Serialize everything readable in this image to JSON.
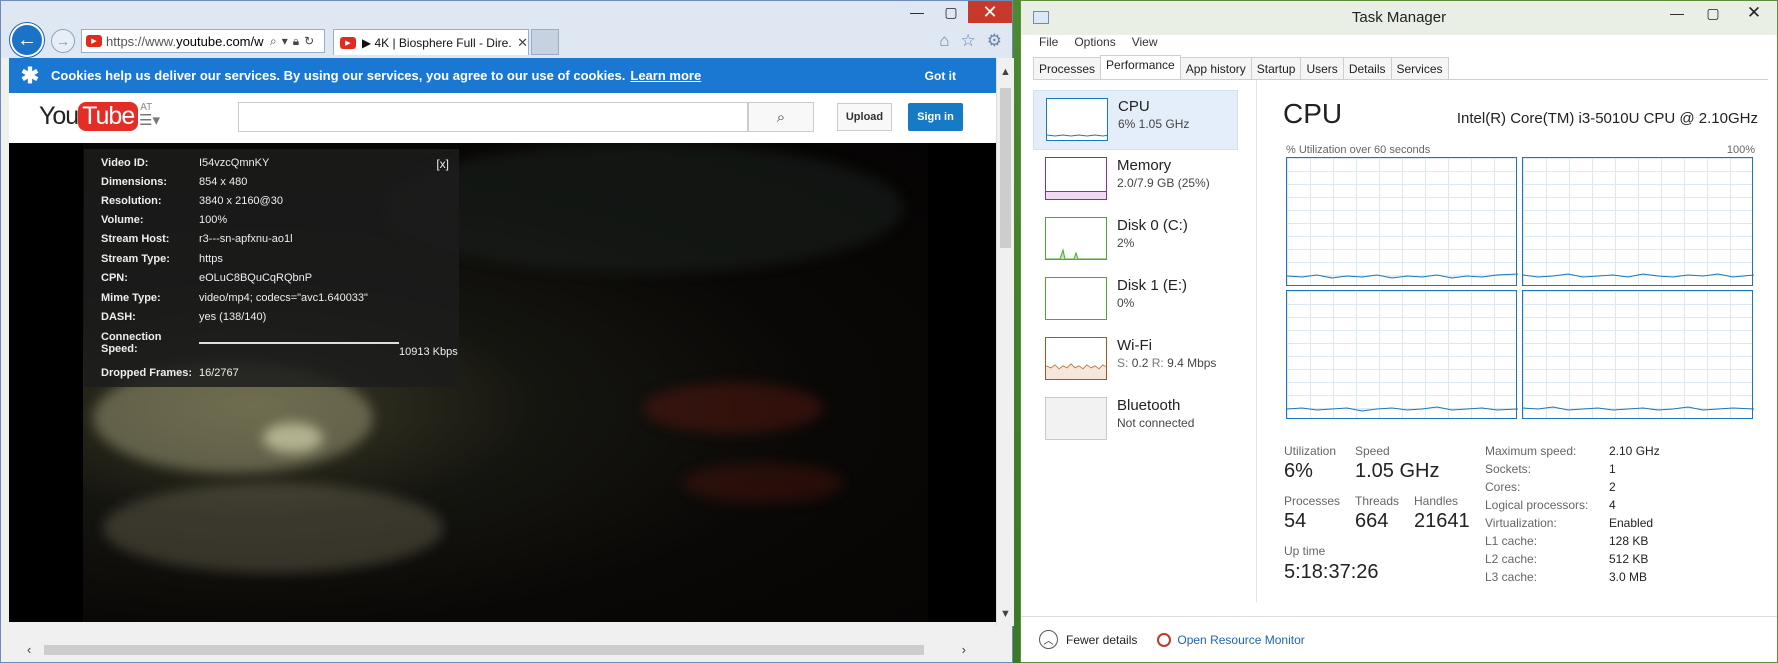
{
  "browser": {
    "url_prefix": "https://www.",
    "url_host": "youtube.com/w",
    "tab_title": "▶ 4K | Biosphere Full - Dire...",
    "cookie_text": "Cookies help us deliver our services. By using our services, you agree to our use of cookies.",
    "cookie_link": "Learn more",
    "cookie_button": "Got it",
    "yt_logo_you": "You",
    "yt_logo_tube": "Tube",
    "yt_region": "AT",
    "upload_label": "Upload",
    "signin_label": "Sign in",
    "stats_close": "[x]",
    "stats": [
      {
        "key": "Video ID:",
        "value": "I54vzcQmnKY"
      },
      {
        "key": "Dimensions:",
        "value": "854 x 480"
      },
      {
        "key": "Resolution:",
        "value": "3840 x 2160@30"
      },
      {
        "key": "Volume:",
        "value": "100%"
      },
      {
        "key": "Stream Host:",
        "value": "r3---sn-apfxnu-ao1l"
      },
      {
        "key": "Stream Type:",
        "value": "https"
      },
      {
        "key": "CPN:",
        "value": "eOLuC8BQuCqRQbnP"
      },
      {
        "key": "Mime Type:",
        "value": "video/mp4; codecs=\"avc1.640033\""
      },
      {
        "key": "DASH:",
        "value": "yes (138/140)"
      },
      {
        "key": "Connection Speed:",
        "value": "10913 Kbps"
      },
      {
        "key": "Dropped Frames:",
        "value": "16/2767"
      }
    ]
  },
  "taskmanager": {
    "title": "Task Manager",
    "menu": [
      "File",
      "Options",
      "View"
    ],
    "tabs": [
      "Processes",
      "Performance",
      "App history",
      "Startup",
      "Users",
      "Details",
      "Services"
    ],
    "active_tab": "Performance",
    "resources": [
      {
        "name": "CPU",
        "sub": "6% 1.05 GHz",
        "color": "#1779ba"
      },
      {
        "name": "Memory",
        "sub": "2.0/7.9 GB (25%)",
        "color": "#8b2d9e"
      },
      {
        "name": "Disk 0 (C:)",
        "sub": "2%",
        "color": "#4caa2c"
      },
      {
        "name": "Disk 1 (E:)",
        "sub": "0%",
        "color": "#4caa2c"
      },
      {
        "name": "Wi-Fi",
        "sub_s": "S:",
        "sub_s_val": "0.2",
        "sub_r": "R:",
        "sub_r_val": "9.4 Mbps",
        "color": "#a7551f"
      },
      {
        "name": "Bluetooth",
        "sub": "Not connected",
        "color": "#9a9a9a"
      }
    ],
    "cpu_heading": "CPU",
    "cpu_model": "Intel(R) Core(TM) i3-5010U CPU @ 2.10GHz",
    "util_label": "% Utilization over 60 seconds",
    "util_max": "100%",
    "utilization_label": "Utilization",
    "utilization": "6%",
    "speed_label": "Speed",
    "speed": "1.05 GHz",
    "processes_label": "Processes",
    "processes": "54",
    "threads_label": "Threads",
    "threads": "664",
    "handles_label": "Handles",
    "handles": "21641",
    "uptime_label": "Up time",
    "uptime": "5:18:37:26",
    "specs": [
      {
        "key": "Maximum speed:",
        "value": "2.10 GHz"
      },
      {
        "key": "Sockets:",
        "value": "1"
      },
      {
        "key": "Cores:",
        "value": "2"
      },
      {
        "key": "Logical processors:",
        "value": "4"
      },
      {
        "key": "Virtualization:",
        "value": "Enabled"
      },
      {
        "key": "L1 cache:",
        "value": "128 KB"
      },
      {
        "key": "L2 cache:",
        "value": "512 KB"
      },
      {
        "key": "L3 cache:",
        "value": "3.0 MB"
      }
    ],
    "fewer_details": "Fewer details",
    "open_resource_monitor": "Open Resource Monitor"
  }
}
